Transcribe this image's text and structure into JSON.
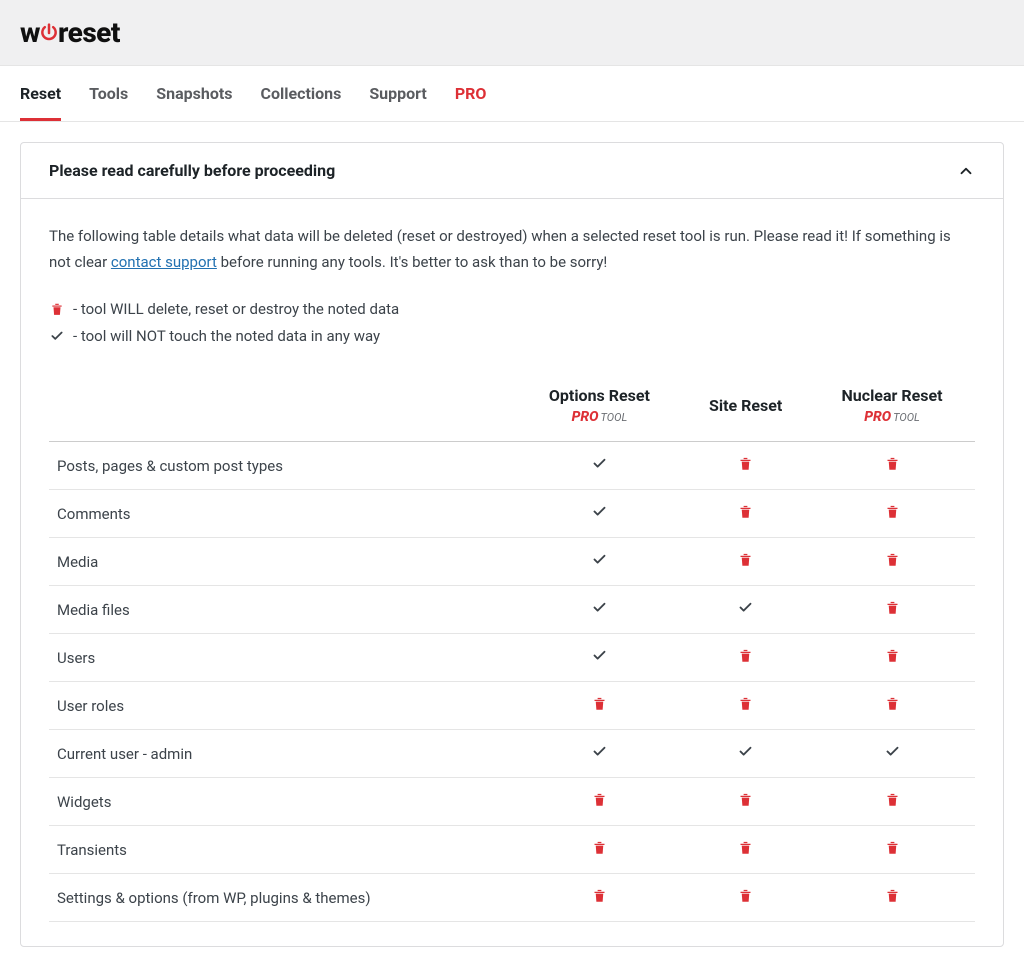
{
  "logo": {
    "prefix": "w",
    "suffix": "reset"
  },
  "tabs": [
    {
      "label": "Reset",
      "active": true
    },
    {
      "label": "Tools"
    },
    {
      "label": "Snapshots"
    },
    {
      "label": "Collections"
    },
    {
      "label": "Support"
    },
    {
      "label": "PRO",
      "pro": true
    }
  ],
  "panel": {
    "title": "Please read carefully before proceeding",
    "intro_prefix": "The following table details what data will be deleted (reset or destroyed) when a selected reset tool is run. Please read it! If something is not clear ",
    "intro_link": "contact support",
    "intro_suffix": " before running any tools. It's better to ask than to be sorry!",
    "legend_delete": " - tool WILL delete, reset or destroy the noted data",
    "legend_keep": " - tool will NOT touch the noted data in any way"
  },
  "table": {
    "columns": [
      {
        "title": "Options Reset",
        "pro": true
      },
      {
        "title": "Site Reset",
        "pro": false
      },
      {
        "title": "Nuclear Reset",
        "pro": true
      }
    ],
    "pro_text": "PRO",
    "tool_text": "TOOL",
    "rows": [
      {
        "label": "Posts, pages & custom post types",
        "cells": [
          "check",
          "trash",
          "trash"
        ]
      },
      {
        "label": "Comments",
        "cells": [
          "check",
          "trash",
          "trash"
        ]
      },
      {
        "label": "Media",
        "cells": [
          "check",
          "trash",
          "trash"
        ]
      },
      {
        "label": "Media files",
        "cells": [
          "check",
          "check",
          "trash"
        ]
      },
      {
        "label": "Users",
        "cells": [
          "check",
          "trash",
          "trash"
        ]
      },
      {
        "label": "User roles",
        "cells": [
          "trash",
          "trash",
          "trash"
        ]
      },
      {
        "label": "Current user - admin",
        "cells": [
          "check",
          "check",
          "check"
        ]
      },
      {
        "label": "Widgets",
        "cells": [
          "trash",
          "trash",
          "trash"
        ]
      },
      {
        "label": "Transients",
        "cells": [
          "trash",
          "trash",
          "trash"
        ]
      },
      {
        "label": "Settings & options (from WP, plugins & themes)",
        "cells": [
          "trash",
          "trash",
          "trash"
        ]
      }
    ]
  }
}
